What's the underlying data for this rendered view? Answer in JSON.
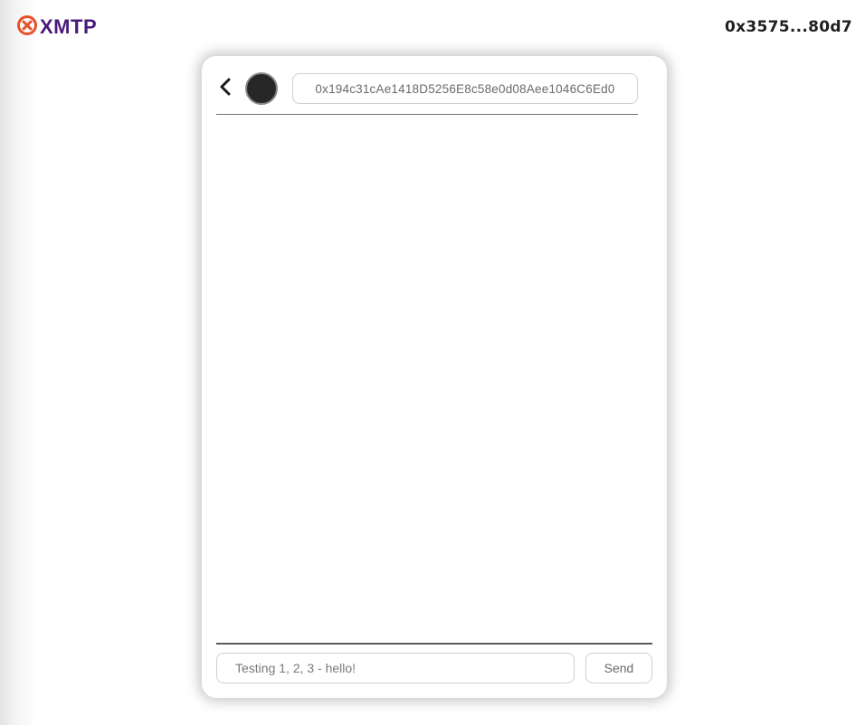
{
  "brand": {
    "name": "XMTP",
    "icon": "xmtp-logo-icon",
    "color": "#4a1a7a",
    "accent": "#e8502a"
  },
  "header": {
    "wallet_address": "0x3575...80d7"
  },
  "conversation": {
    "back_icon": "chevron-left-icon",
    "recipient_address": "0x194c31cAe1418D5256E8c58e0d08Aee1046C6Ed0",
    "messages": []
  },
  "composer": {
    "placeholder": "Testing 1, 2, 3 - hello!",
    "value": "",
    "send_label": "Send"
  }
}
